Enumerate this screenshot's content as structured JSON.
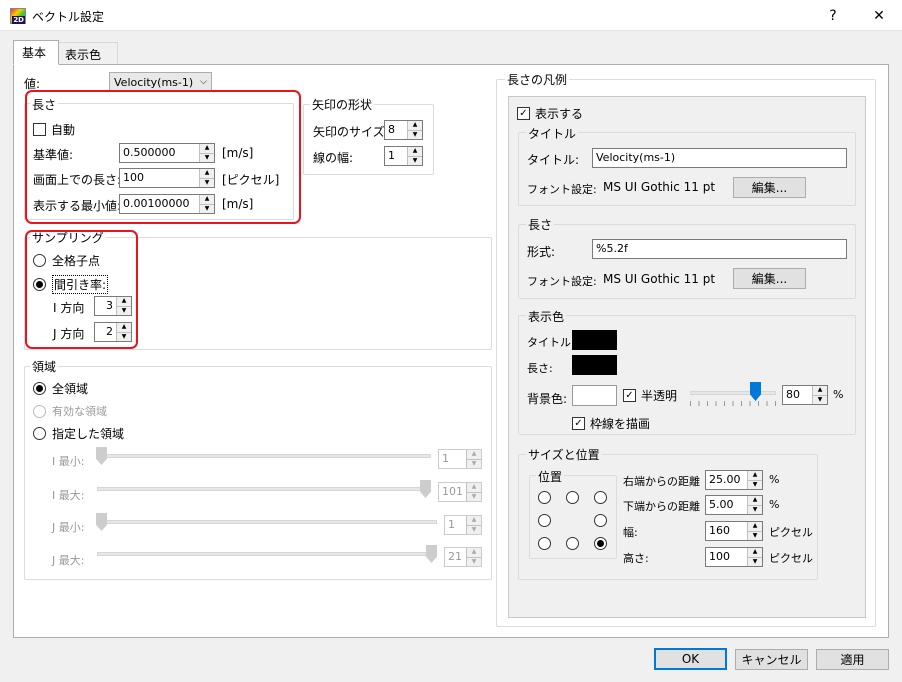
{
  "window": {
    "title": "ベクトル設定",
    "help": "?",
    "close": "✕"
  },
  "tabs": [
    "基本",
    "表示色"
  ],
  "value": {
    "label": "値:",
    "selected": "Velocity(ms-1)"
  },
  "length": {
    "title": "長さ",
    "auto": "自動",
    "base_label": "基準値:",
    "base_value": "0.500000",
    "base_unit": "[m/s]",
    "screen_label": "画面上での長さ:",
    "screen_value": "100",
    "screen_unit": "[ピクセル]",
    "min_label": "表示する最小値:",
    "min_value": "0.00100000",
    "min_unit": "[m/s]"
  },
  "arrow": {
    "title": "矢印の形状",
    "size_label": "矢印のサイズ:",
    "size_value": "8",
    "width_label": "線の幅:",
    "width_value": "1"
  },
  "sampling": {
    "title": "サンプリング",
    "all": "全格子点",
    "thin": "間引き率:",
    "i_label": "I 方向",
    "i_value": "3",
    "j_label": "J 方向",
    "j_value": "2"
  },
  "region": {
    "title": "領域",
    "all": "全領域",
    "valid": "有効な領域",
    "specified": "指定した領域",
    "i_min_label": "I 最小:",
    "i_min": "1",
    "i_max_label": "I 最大:",
    "i_max": "101",
    "j_min_label": "J 最小:",
    "j_min": "1",
    "j_max_label": "J 最大:",
    "j_max": "21"
  },
  "legend": {
    "title": "長さの凡例",
    "show": "表示する",
    "title_group": {
      "title": "タイトル",
      "label": "タイトル:",
      "value": "Velocity(ms-1)",
      "font_label": "フォント設定:",
      "font": "MS UI Gothic 11 pt",
      "edit": "編集..."
    },
    "length_group": {
      "title": "長さ",
      "format_label": "形式:",
      "format": "%5.2f",
      "font_label": "フォント設定:",
      "font": "MS UI Gothic 11 pt",
      "edit": "編集..."
    },
    "colors": {
      "title": "表示色",
      "title_label": "タイトル:",
      "length_label": "長さ:",
      "bg_label": "背景色:",
      "translucent": "半透明",
      "opacity": "80",
      "percent": "%",
      "frame": "枠線を描画"
    },
    "size_pos": {
      "title": "サイズと位置",
      "pos_title": "位置",
      "right_label": "右端からの距離",
      "right_value": "25.00",
      "right_unit": "%",
      "bottom_label": "下端からの距離",
      "bottom_value": "5.00",
      "bottom_unit": "%",
      "width_label": "幅:",
      "width_value": "160",
      "width_unit": "ピクセル",
      "height_label": "高さ:",
      "height_value": "100",
      "height_unit": "ピクセル"
    }
  },
  "buttons": {
    "ok": "OK",
    "cancel": "キャンセル",
    "apply": "適用"
  },
  "colors": {
    "accent": "#0078d7",
    "highlight": "#e8141e",
    "swatch": "#000000"
  }
}
